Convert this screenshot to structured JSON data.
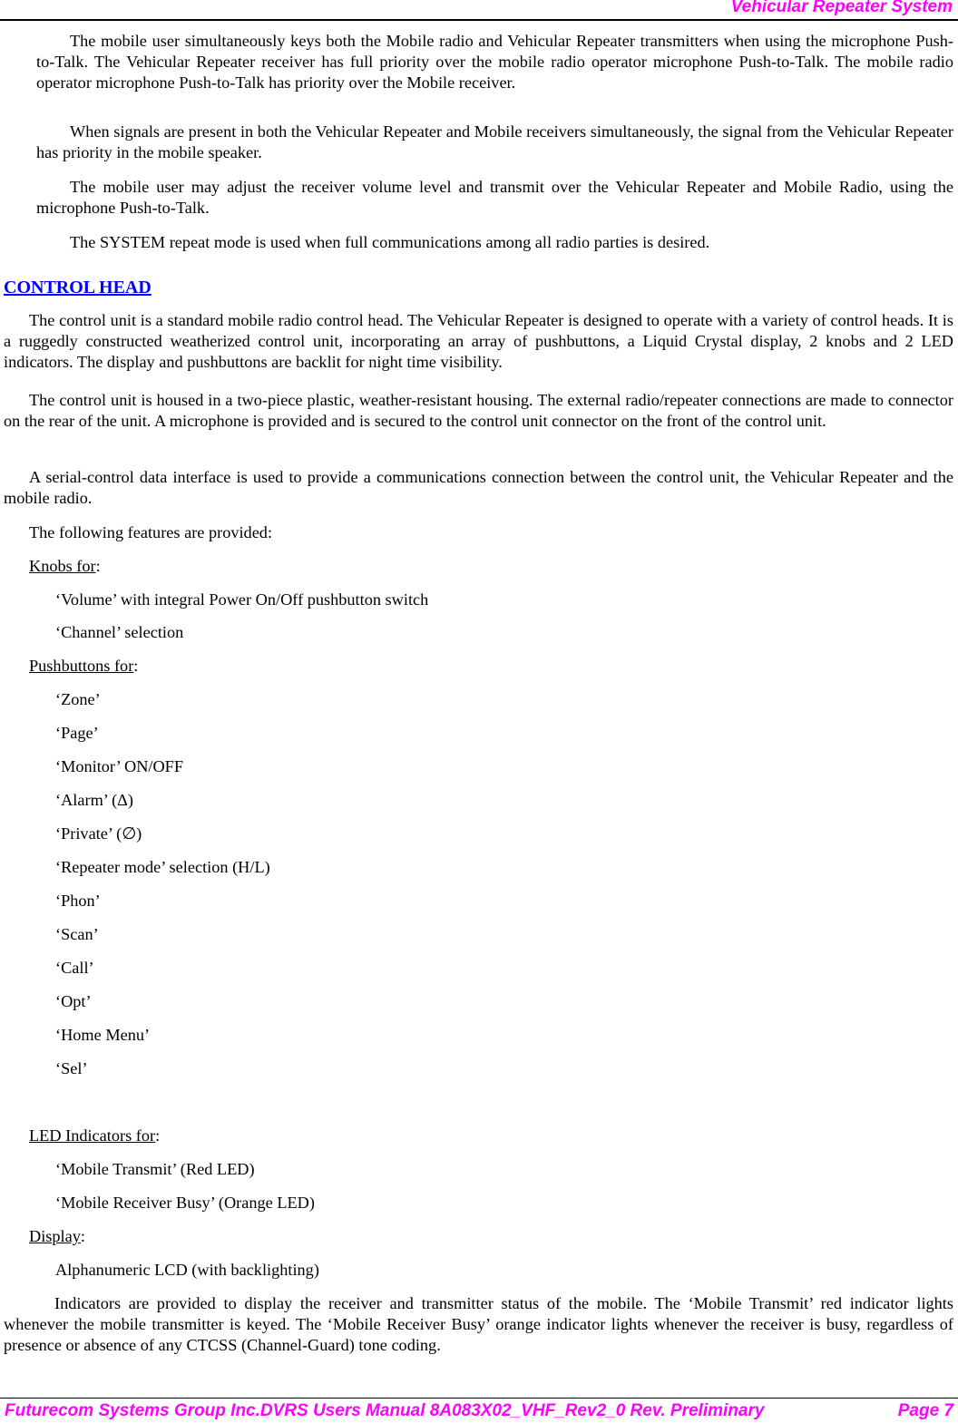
{
  "header": {
    "title": "Vehicular Repeater System",
    "title_color": "#ff00ff"
  },
  "intro_paragraphs": [
    "The mobile user simultaneously keys both the Mobile radio and Vehicular Repeater transmitters when using the microphone Push-to-Talk. The Vehicular Repeater receiver has full priority over the mobile radio operator microphone Push-to-Talk. The mobile radio operator microphone Push-to-Talk has priority over the Mobile receiver.",
    "When signals are present in both the Vehicular Repeater and Mobile receivers simultaneously, the signal from the Vehicular Repeater has priority in the mobile speaker.",
    "The mobile user may adjust the receiver volume level and transmit over the Vehicular Repeater and Mobile Radio, using the microphone Push-to-Talk.",
    "The SYSTEM repeat mode is used when full communications among all radio parties is desired."
  ],
  "section": {
    "heading": "CONTROL HEAD",
    "heading_color": "#0000ff",
    "paragraphs": [
      "The control unit is a standard mobile radio control head. The Vehicular Repeater is designed to operate with a variety of control heads. It is a ruggedly constructed weatherized control unit, incorporating an array of pushbuttons, a Liquid Crystal display, 2 knobs and 2 LED indicators. The display and pushbuttons are backlit for night time visibility.",
      "The control unit is housed in a two-piece plastic, weather-resistant housing. The external radio/repeater connections are made to connector on the rear of the unit. A microphone is provided and is secured to the control unit connector on the front of the control unit.",
      "A serial-control data interface is used to provide a communications connection between the control unit, the Vehicular Repeater and the mobile radio.",
      "The following features are provided:"
    ],
    "knobs": {
      "label": "Knobs for",
      "suffix": ":",
      "items": [
        "‘Volume’ with integral Power On/Off pushbutton switch",
        "‘Channel’ selection"
      ]
    },
    "pushbuttons": {
      "label": "Pushbuttons for",
      "suffix": ":",
      "items": [
        "‘Zone’",
        "‘Page’",
        "‘Monitor’ ON/OFF",
        "‘Alarm’ (Δ)",
        "‘Private’ (∅)",
        "‘Repeater mode’ selection (H/L)",
        "‘Phon’",
        "‘Scan’",
        "‘Call’",
        "‘Opt’",
        "‘Home Menu’",
        "‘Sel’"
      ]
    },
    "leds": {
      "label": "LED Indicators for",
      "suffix": ":",
      "items": [
        "‘Mobile Transmit’ (Red LED)",
        "‘Mobile Receiver Busy’ (Orange LED)"
      ]
    },
    "display": {
      "label": "Display",
      "suffix": ":",
      "items": [
        "Alphanumeric LCD (with backlighting)"
      ]
    },
    "closing_paragraph": "Indicators are provided to display the receiver and transmitter status of the mobile. The ‘Mobile Transmit’ red indicator lights whenever the mobile transmitter is keyed. The ‘Mobile Receiver Busy’ orange indicator lights whenever the receiver is busy, regardless of presence or absence of any CTCSS (Channel-Guard) tone coding."
  },
  "footer": {
    "left": "Futurecom Systems Group Inc.DVRS Users Manual 8A083X02_VHF_Rev2_0 Rev. Preliminary",
    "right": "Page 7",
    "color": "#ff00ff"
  }
}
